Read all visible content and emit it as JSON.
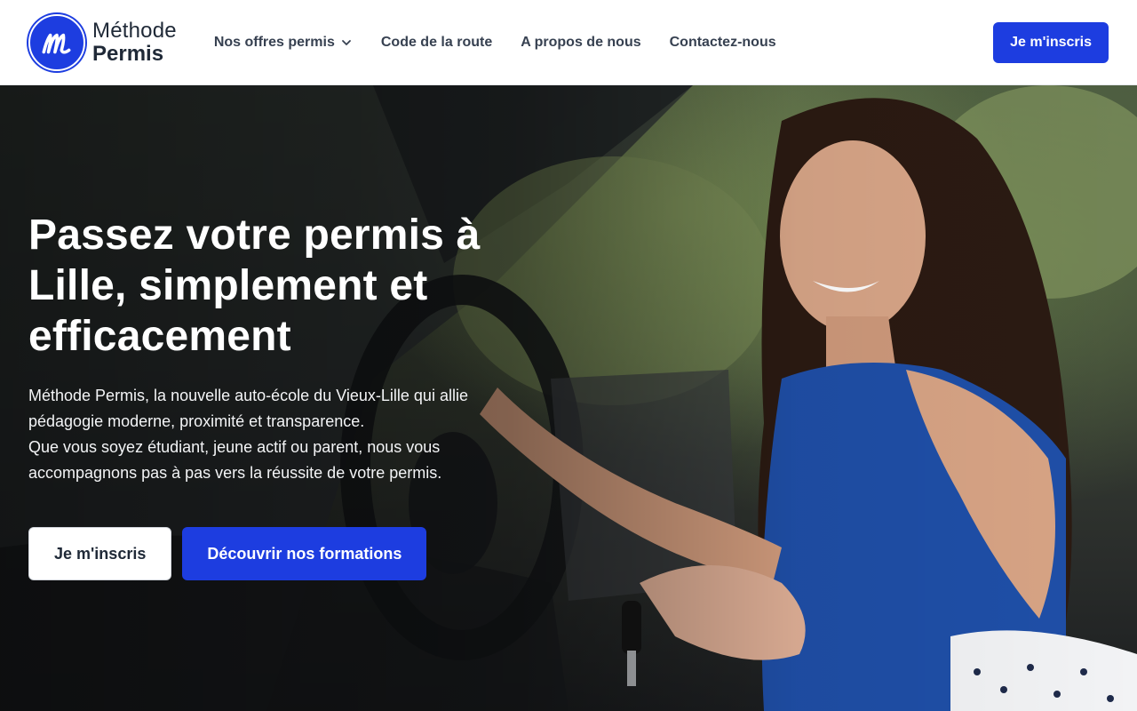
{
  "brand": {
    "line1": "Méthode",
    "line2": "Permis",
    "logo_icon": "m-letter-logo-icon",
    "color": "#1d3de0"
  },
  "nav": {
    "items": [
      {
        "label": "Nos offres permis",
        "has_dropdown": true
      },
      {
        "label": "Code de la route"
      },
      {
        "label": "A propos de nous"
      },
      {
        "label": "Contactez-nous"
      }
    ],
    "cta_label": "Je m'inscris"
  },
  "hero": {
    "title": "Passez votre permis à Lille, simplement et efficacement",
    "desc_line1": "Méthode Permis, la nouvelle auto-école du Vieux-Lille qui allie pédagogie moderne, proximité et transparence.",
    "desc_line2": "Que vous soyez étudiant, jeune actif ou parent, nous vous accompagnons pas à pas vers la réussite de votre permis.",
    "primary_button": "Je m'inscris",
    "secondary_button": "Découvrir nos formations",
    "image": "smiling-woman-in-car-holding-key-photo"
  },
  "colors": {
    "accent": "#1d3de0",
    "nav_text": "#374151",
    "white": "#ffffff"
  }
}
